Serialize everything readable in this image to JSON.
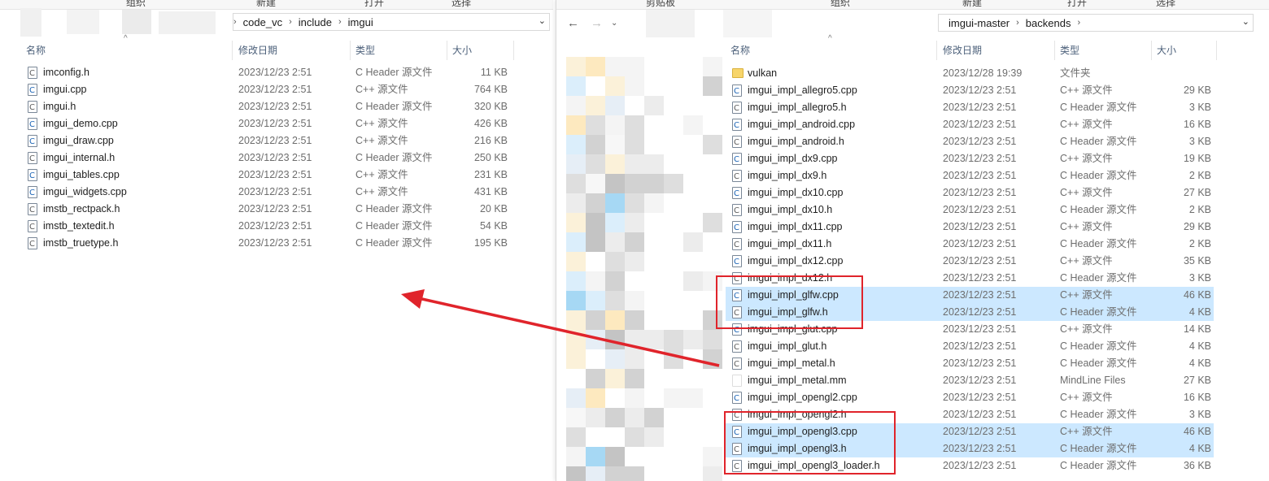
{
  "ribbon": {
    "left_labels": [
      "组织",
      "新建",
      "打开",
      "选择"
    ],
    "right_labels": [
      "剪贴板",
      "组织",
      "新建",
      "打开",
      "选择"
    ]
  },
  "left": {
    "breadcrumb": [
      "code_vc",
      "include",
      "imgui"
    ],
    "columns": {
      "name": "名称",
      "date": "修改日期",
      "type": "类型",
      "size": "大小"
    },
    "files": [
      {
        "name": "imconfig.h",
        "date": "2023/12/23 2:51",
        "type": "C Header 源文件",
        "size": "11 KB",
        "kind": "h"
      },
      {
        "name": "imgui.cpp",
        "date": "2023/12/23 2:51",
        "type": "C++ 源文件",
        "size": "764 KB",
        "kind": "cpp"
      },
      {
        "name": "imgui.h",
        "date": "2023/12/23 2:51",
        "type": "C Header 源文件",
        "size": "320 KB",
        "kind": "h"
      },
      {
        "name": "imgui_demo.cpp",
        "date": "2023/12/23 2:51",
        "type": "C++ 源文件",
        "size": "426 KB",
        "kind": "cpp"
      },
      {
        "name": "imgui_draw.cpp",
        "date": "2023/12/23 2:51",
        "type": "C++ 源文件",
        "size": "216 KB",
        "kind": "cpp"
      },
      {
        "name": "imgui_internal.h",
        "date": "2023/12/23 2:51",
        "type": "C Header 源文件",
        "size": "250 KB",
        "kind": "h"
      },
      {
        "name": "imgui_tables.cpp",
        "date": "2023/12/23 2:51",
        "type": "C++ 源文件",
        "size": "231 KB",
        "kind": "cpp"
      },
      {
        "name": "imgui_widgets.cpp",
        "date": "2023/12/23 2:51",
        "type": "C++ 源文件",
        "size": "431 KB",
        "kind": "cpp"
      },
      {
        "name": "imstb_rectpack.h",
        "date": "2023/12/23 2:51",
        "type": "C Header 源文件",
        "size": "20 KB",
        "kind": "h"
      },
      {
        "name": "imstb_textedit.h",
        "date": "2023/12/23 2:51",
        "type": "C Header 源文件",
        "size": "54 KB",
        "kind": "h"
      },
      {
        "name": "imstb_truetype.h",
        "date": "2023/12/23 2:51",
        "type": "C Header 源文件",
        "size": "195 KB",
        "kind": "h"
      }
    ]
  },
  "right": {
    "breadcrumb": [
      "imgui-master",
      "backends"
    ],
    "columns": {
      "name": "名称",
      "date": "修改日期",
      "type": "类型",
      "size": "大小"
    },
    "files": [
      {
        "name": "vulkan",
        "date": "2023/12/28 19:39",
        "type": "文件夹",
        "size": "",
        "kind": "folder",
        "selected": false
      },
      {
        "name": "imgui_impl_allegro5.cpp",
        "date": "2023/12/23 2:51",
        "type": "C++ 源文件",
        "size": "29 KB",
        "kind": "cpp",
        "selected": false
      },
      {
        "name": "imgui_impl_allegro5.h",
        "date": "2023/12/23 2:51",
        "type": "C Header 源文件",
        "size": "3 KB",
        "kind": "h",
        "selected": false
      },
      {
        "name": "imgui_impl_android.cpp",
        "date": "2023/12/23 2:51",
        "type": "C++ 源文件",
        "size": "16 KB",
        "kind": "cpp",
        "selected": false
      },
      {
        "name": "imgui_impl_android.h",
        "date": "2023/12/23 2:51",
        "type": "C Header 源文件",
        "size": "3 KB",
        "kind": "h",
        "selected": false
      },
      {
        "name": "imgui_impl_dx9.cpp",
        "date": "2023/12/23 2:51",
        "type": "C++ 源文件",
        "size": "19 KB",
        "kind": "cpp",
        "selected": false
      },
      {
        "name": "imgui_impl_dx9.h",
        "date": "2023/12/23 2:51",
        "type": "C Header 源文件",
        "size": "2 KB",
        "kind": "h",
        "selected": false
      },
      {
        "name": "imgui_impl_dx10.cpp",
        "date": "2023/12/23 2:51",
        "type": "C++ 源文件",
        "size": "27 KB",
        "kind": "cpp",
        "selected": false
      },
      {
        "name": "imgui_impl_dx10.h",
        "date": "2023/12/23 2:51",
        "type": "C Header 源文件",
        "size": "2 KB",
        "kind": "h",
        "selected": false
      },
      {
        "name": "imgui_impl_dx11.cpp",
        "date": "2023/12/23 2:51",
        "type": "C++ 源文件",
        "size": "29 KB",
        "kind": "cpp",
        "selected": false
      },
      {
        "name": "imgui_impl_dx11.h",
        "date": "2023/12/23 2:51",
        "type": "C Header 源文件",
        "size": "2 KB",
        "kind": "h",
        "selected": false
      },
      {
        "name": "imgui_impl_dx12.cpp",
        "date": "2023/12/23 2:51",
        "type": "C++ 源文件",
        "size": "35 KB",
        "kind": "cpp",
        "selected": false
      },
      {
        "name": "imgui_impl_dx12.h",
        "date": "2023/12/23 2:51",
        "type": "C Header 源文件",
        "size": "3 KB",
        "kind": "h",
        "selected": false
      },
      {
        "name": "imgui_impl_glfw.cpp",
        "date": "2023/12/23 2:51",
        "type": "C++ 源文件",
        "size": "46 KB",
        "kind": "cpp",
        "selected": true
      },
      {
        "name": "imgui_impl_glfw.h",
        "date": "2023/12/23 2:51",
        "type": "C Header 源文件",
        "size": "4 KB",
        "kind": "h",
        "selected": true
      },
      {
        "name": "imgui_impl_glut.cpp",
        "date": "2023/12/23 2:51",
        "type": "C++ 源文件",
        "size": "14 KB",
        "kind": "cpp",
        "selected": false
      },
      {
        "name": "imgui_impl_glut.h",
        "date": "2023/12/23 2:51",
        "type": "C Header 源文件",
        "size": "4 KB",
        "kind": "h",
        "selected": false
      },
      {
        "name": "imgui_impl_metal.h",
        "date": "2023/12/23 2:51",
        "type": "C Header 源文件",
        "size": "4 KB",
        "kind": "h",
        "selected": false
      },
      {
        "name": "imgui_impl_metal.mm",
        "date": "2023/12/23 2:51",
        "type": "MindLine Files",
        "size": "27 KB",
        "kind": "mm",
        "selected": false
      },
      {
        "name": "imgui_impl_opengl2.cpp",
        "date": "2023/12/23 2:51",
        "type": "C++ 源文件",
        "size": "16 KB",
        "kind": "cpp",
        "selected": false
      },
      {
        "name": "imgui_impl_opengl2.h",
        "date": "2023/12/23 2:51",
        "type": "C Header 源文件",
        "size": "3 KB",
        "kind": "h",
        "selected": false
      },
      {
        "name": "imgui_impl_opengl3.cpp",
        "date": "2023/12/23 2:51",
        "type": "C++ 源文件",
        "size": "46 KB",
        "kind": "cpp",
        "selected": true
      },
      {
        "name": "imgui_impl_opengl3.h",
        "date": "2023/12/23 2:51",
        "type": "C Header 源文件",
        "size": "4 KB",
        "kind": "h",
        "selected": true
      },
      {
        "name": "imgui_impl_opengl3_loader.h",
        "date": "2023/12/23 2:51",
        "type": "C Header 源文件",
        "size": "36 KB",
        "kind": "h",
        "selected": false
      }
    ]
  },
  "colors": {
    "selection": "#cce8ff",
    "annotation_red": "#e0242b",
    "header_text": "#4c607a"
  }
}
